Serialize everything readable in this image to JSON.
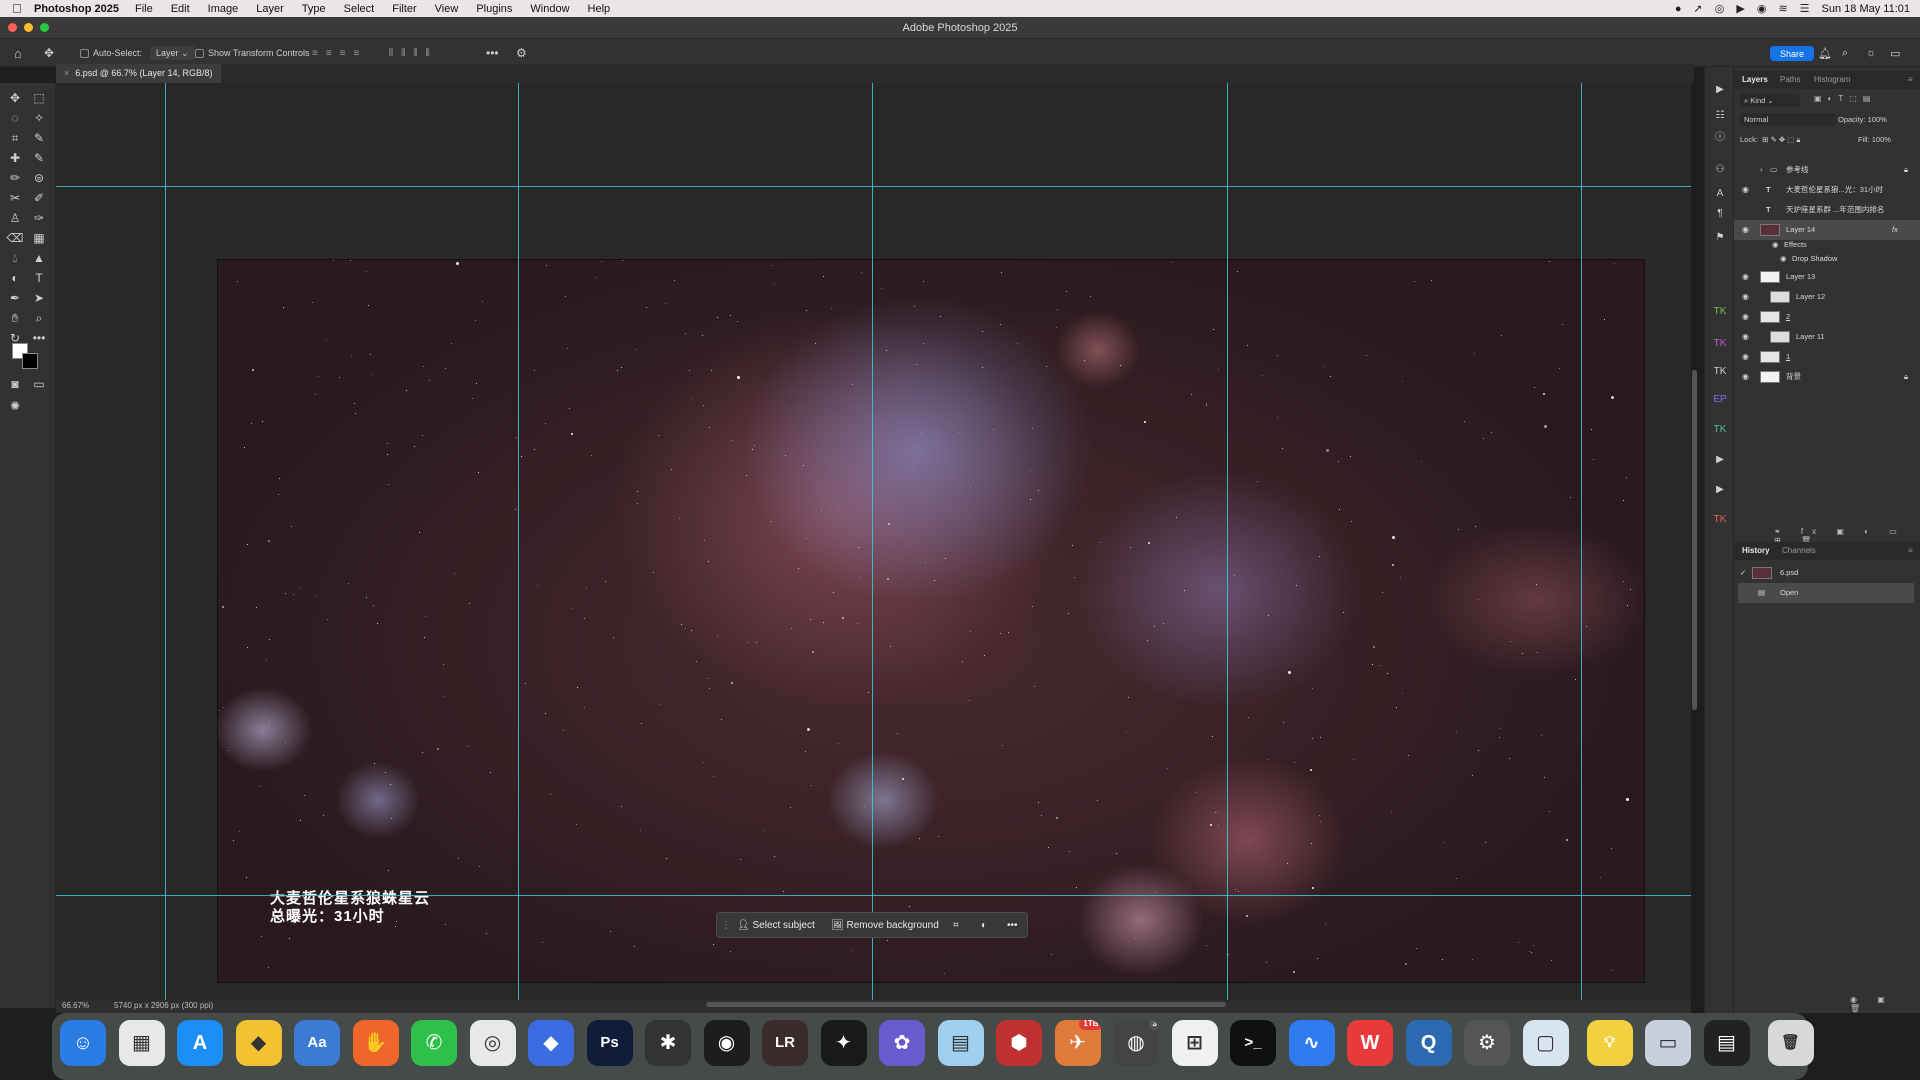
{
  "menubar": {
    "app_name": "Photoshop 2025",
    "items": [
      "File",
      "Edit",
      "Image",
      "Layer",
      "Type",
      "Select",
      "Filter",
      "View",
      "Plugins",
      "Window",
      "Help"
    ],
    "datetime": "Sun 18 May  11:01"
  },
  "window": {
    "title": "Adobe Photoshop 2025"
  },
  "options": {
    "auto_select_label": "Auto-Select:",
    "auto_select_value": "Layer",
    "transform_label": "Show Transform Controls",
    "share_label": "Share"
  },
  "document": {
    "tab_label": "6.psd @ 66.7% (Layer 14, RGB/8)",
    "caption_line1": "大麦哲伦星系狼蛛星云",
    "caption_line2": "总曝光：31小时"
  },
  "context_bar": {
    "select_subject": "Select subject",
    "remove_background": "Remove background"
  },
  "status": {
    "zoom": "66.67%",
    "doc_info": "5740 px x 2906 px (300 ppi)"
  },
  "layers_panel": {
    "tabs": [
      "Layers",
      "Paths",
      "Histogram"
    ],
    "filter_kind": "Kind",
    "blend_mode": "Normal",
    "opacity_label": "Opacity:",
    "opacity_value": "100%",
    "lock_label": "Lock:",
    "fill_label": "Fill:",
    "fill_value": "100%",
    "layers": [
      {
        "name": "参考线"
      },
      {
        "name": "大麦哲伦星系狼...光：31小时"
      },
      {
        "name": "天炉座星系群 ...年范围内排名"
      },
      {
        "name": "Layer 14"
      },
      {
        "name": "Effects"
      },
      {
        "name": "Drop Shadow"
      },
      {
        "name": "Layer 13"
      },
      {
        "name": "Layer 12"
      },
      {
        "name": "2"
      },
      {
        "name": "Layer 11"
      },
      {
        "name": "1"
      },
      {
        "name": "背景"
      }
    ]
  },
  "history_panel": {
    "tabs": [
      "History",
      "Channels"
    ],
    "snapshot": "6.psd",
    "items": [
      "Open"
    ]
  },
  "dock": {
    "apps": [
      "Finder",
      "Launchpad",
      "App Store",
      "Notes",
      "Dictionary",
      "Hand Mirror",
      "WeChat",
      "Chrome",
      "Crystal",
      "Ps",
      "Final Cut",
      "DaVinci",
      "Timelapse",
      "Affinity",
      "Snow",
      "Files",
      "Paint",
      "Bird",
      "Camera",
      "Screen",
      "Terminal",
      "Lark",
      "WPS",
      "QSpace",
      "Settings",
      "Preview",
      "Bulb",
      "Mirror",
      "Doc",
      "Trash"
    ],
    "badge_text": "1TB",
    "badge_text_2": "3"
  },
  "colors": {
    "guide": "#3ec6e0",
    "accent": "#1473e6"
  }
}
